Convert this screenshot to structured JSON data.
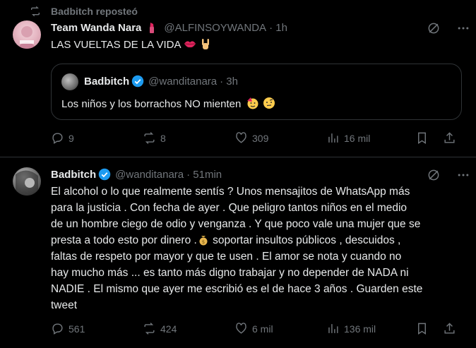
{
  "retweet": {
    "label": "Badbitch reposteó"
  },
  "tweet1": {
    "name": "Team Wanda Nara",
    "handle": "@ALFINSOYWANDA",
    "time": "· 1h",
    "text": "LAS VUELTAS DE LA VIDA",
    "quote": {
      "name": "Badbitch",
      "handle": "@wanditanara",
      "time": "· 3h",
      "text": "Los niños y los borrachos NO mienten"
    },
    "stats": {
      "replies": "9",
      "reposts": "8",
      "likes": "309",
      "views": "16 mil"
    }
  },
  "tweet2": {
    "name": "Badbitch",
    "handle": "@wanditanara",
    "time": "· 51min",
    "lines": [
      "El alcohol o lo que realmente sentís ? Unos mensajitos de WhatsApp más",
      "para la justicia . Con fecha de ayer . Que peligro tantos niños  en el medio",
      "de un hombre ciego de odio y venganza . Y que poco vale una mujer que se",
      "presta a todo esto por dinero .",
      " soportar insultos públicos , descuidos ,",
      "faltas de respeto por mayor y  que te usen  . El amor se nota y cuando no",
      "hay mucho más ... es tanto más digno trabajar y no depender de NADA ni",
      "NADIE . El mismo que ayer me escribió es el de hace 3 años . Guarden este",
      "tweet"
    ],
    "stats": {
      "replies": "561",
      "reposts": "424",
      "likes": "6 mil",
      "views": "136 mil"
    }
  },
  "colors": {
    "background": "#000000",
    "text": "#e7e9ea",
    "muted": "#71767b",
    "border": "#2f3336",
    "verified": "#1d9bf0"
  },
  "icons": [
    "repost-icon",
    "verified-badge-icon",
    "grok-icon",
    "more-icon",
    "reply-icon",
    "like-icon",
    "views-icon",
    "bookmark-icon",
    "share-icon"
  ]
}
